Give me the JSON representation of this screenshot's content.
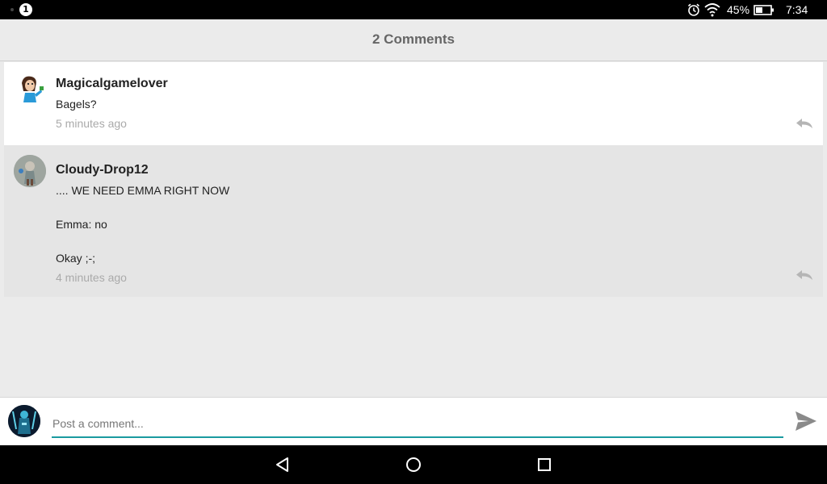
{
  "status_bar": {
    "notification_count": "1",
    "battery_percent": "45%",
    "time": "7:34",
    "icons": [
      "alarm-icon",
      "wifi-icon",
      "battery-icon"
    ]
  },
  "header": {
    "title": "2 Comments"
  },
  "comments": [
    {
      "author": "Magicalgamelover",
      "lines": [
        "Bagels?"
      ],
      "time": "5 minutes ago"
    },
    {
      "author": "Cloudy-Drop12",
      "lines": [
        ".... WE NEED EMMA RIGHT NOW",
        "Emma: no",
        "Okay ;-;"
      ],
      "time": "4 minutes ago"
    }
  ],
  "composer": {
    "placeholder": "Post a comment..."
  },
  "nav": {
    "icons": [
      "back-icon",
      "home-icon",
      "recents-icon"
    ]
  },
  "colors": {
    "accent": "#1a9aa0",
    "status_bar": "#000000",
    "nav_bar": "#000000",
    "background": "#ebebeb"
  }
}
